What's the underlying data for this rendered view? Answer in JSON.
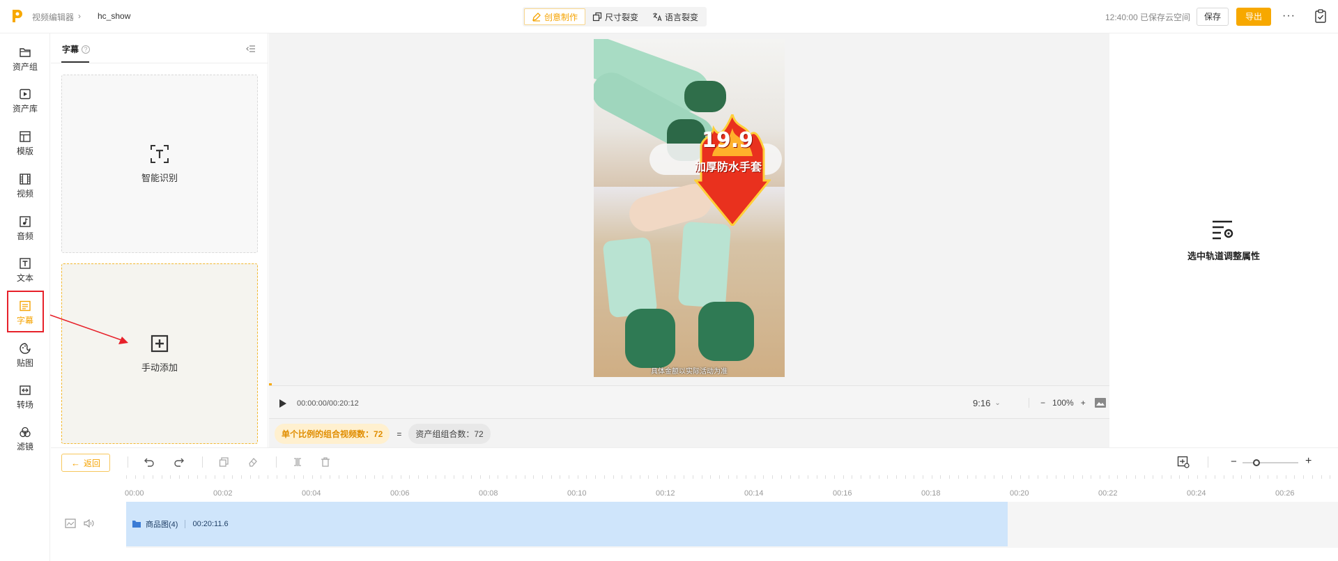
{
  "colors": {
    "accent": "#f5a300",
    "export_bg": "#f7a800",
    "annotation": "#e7212a",
    "clip_bg": "#cfe5fb"
  },
  "header": {
    "breadcrumb_root": "视频编辑器",
    "breadcrumb_current": "hc_show",
    "modes": [
      {
        "label": "创意制作",
        "icon": "pencil-icon",
        "active": true
      },
      {
        "label": "尺寸裂变",
        "icon": "resize-icon",
        "active": false
      },
      {
        "label": "语言裂变",
        "icon": "translate-icon",
        "active": false
      }
    ],
    "save_status": "12:40:00 已保存云空间",
    "save_label": "保存",
    "export_label": "导出",
    "more_label": "···"
  },
  "nav": [
    {
      "label": "资产组",
      "icon": "folder-icon"
    },
    {
      "label": "资产库",
      "icon": "play-box-icon"
    },
    {
      "label": "模版",
      "icon": "template-icon"
    },
    {
      "label": "视频",
      "icon": "film-icon"
    },
    {
      "label": "音频",
      "icon": "music-icon"
    },
    {
      "label": "文本",
      "icon": "text-icon"
    },
    {
      "label": "字幕",
      "icon": "subtitle-icon",
      "active": true
    },
    {
      "label": "贴图",
      "icon": "sticker-icon"
    },
    {
      "label": "转场",
      "icon": "transition-icon"
    },
    {
      "label": "滤镜",
      "icon": "filter-icon"
    }
  ],
  "panel": {
    "tab": "字幕",
    "help": "?",
    "auto_label": "智能识别",
    "manual_label": "手动添加"
  },
  "preview": {
    "price": "19.9",
    "product": "加厚防水手套",
    "caption": "具体金额以实际活动为准",
    "time": "00:00:00/00:20:12",
    "ratio": "9:16",
    "zoom": "100%",
    "zoom_minus": "−",
    "zoom_plus": "+",
    "badge_combo": "单个比例的组合视频数：72",
    "equals": "=",
    "badge_assets": "资产组组合数：72"
  },
  "properties": {
    "hint": "选中轨道调整属性"
  },
  "toolbar": {
    "back_label": "返回",
    "zoom_level": 0.25
  },
  "timeline": {
    "ticks": [
      "00:00",
      "00:02",
      "00:04",
      "00:06",
      "00:08",
      "00:10",
      "00:12",
      "00:14",
      "00:16",
      "00:18",
      "00:20",
      "00:22",
      "00:24",
      "00:26"
    ],
    "clip_name": "商品图(4)",
    "clip_duration": "00:20:11.6"
  }
}
